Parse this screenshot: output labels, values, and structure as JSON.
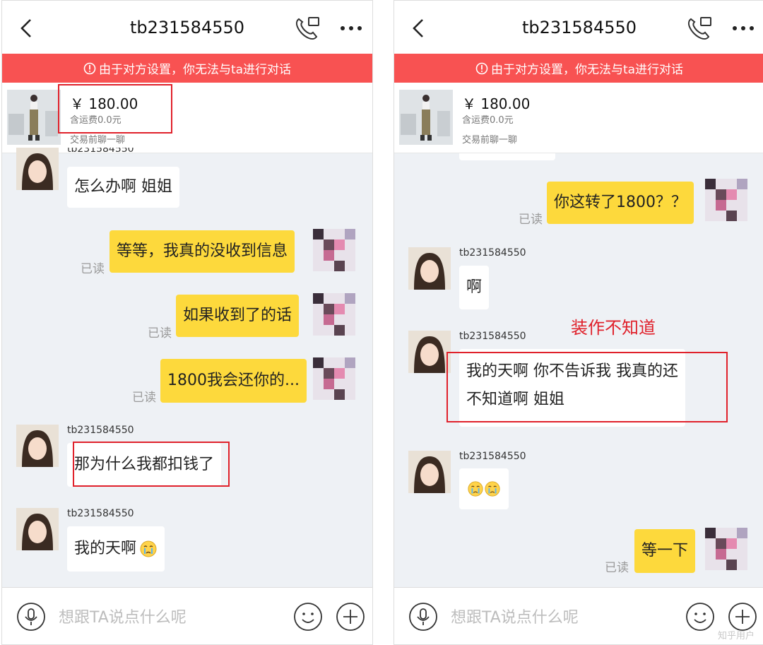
{
  "screens": [
    {
      "header": {
        "title": "tb231584550"
      },
      "banner": {
        "text": "由于对方设置，你无法与ta进行对话"
      },
      "product": {
        "price": "￥ 180.00",
        "shipping": "含运费0.0元",
        "chat_before": "交易前聊一聊"
      },
      "messages": [
        {
          "sender": "tb231584550",
          "text": "怎么办啊 姐姐"
        },
        {
          "text": "等等，我真的没收到信息",
          "status": "已读"
        },
        {
          "text": "如果收到了的话",
          "status": "已读"
        },
        {
          "text": "1800我会还你的...",
          "status": "已读"
        },
        {
          "sender": "tb231584550",
          "text": "那为什么我都扣钱了"
        },
        {
          "sender": "tb231584550",
          "text": "我的天啊"
        }
      ],
      "input": {
        "placeholder": "想跟TA说点什么呢"
      }
    },
    {
      "header": {
        "title": "tb231584550"
      },
      "banner": {
        "text": "由于对方设置，你无法与ta进行对话"
      },
      "product": {
        "price": "￥ 180.00",
        "shipping": "含运费0.0元",
        "chat_before": "交易前聊一聊"
      },
      "messages": [
        {
          "text": "你这转了1800？？",
          "status": "已读"
        },
        {
          "sender": "tb231584550",
          "text": "啊"
        },
        {
          "sender": "tb231584550",
          "text_line1": "我的天啊 你不告诉我 我真的还",
          "text_line2": "不知道啊 姐姐"
        },
        {
          "sender": "tb231584550",
          "text": ""
        },
        {
          "text": "等一下",
          "status": "已读"
        }
      ],
      "annotation": "装作不知道",
      "input": {
        "placeholder": "想跟TA说点什么呢"
      },
      "watermark": "知乎用户"
    }
  ],
  "icons": {
    "back": "chevron-left-icon",
    "call": "phone-icon",
    "more": "more-dots-icon",
    "warn": "exclamation-circle-icon",
    "mic": "microphone-icon",
    "emoji": "smiley-icon",
    "plus": "plus-circle-icon",
    "crying": "crying-face-icon"
  },
  "colors": {
    "banner": "#f85252",
    "outgoing_bubble": "#fdd93c",
    "incoming_bubble": "#ffffff",
    "chat_bg": "#eef1f5",
    "highlight": "#e0212b"
  }
}
